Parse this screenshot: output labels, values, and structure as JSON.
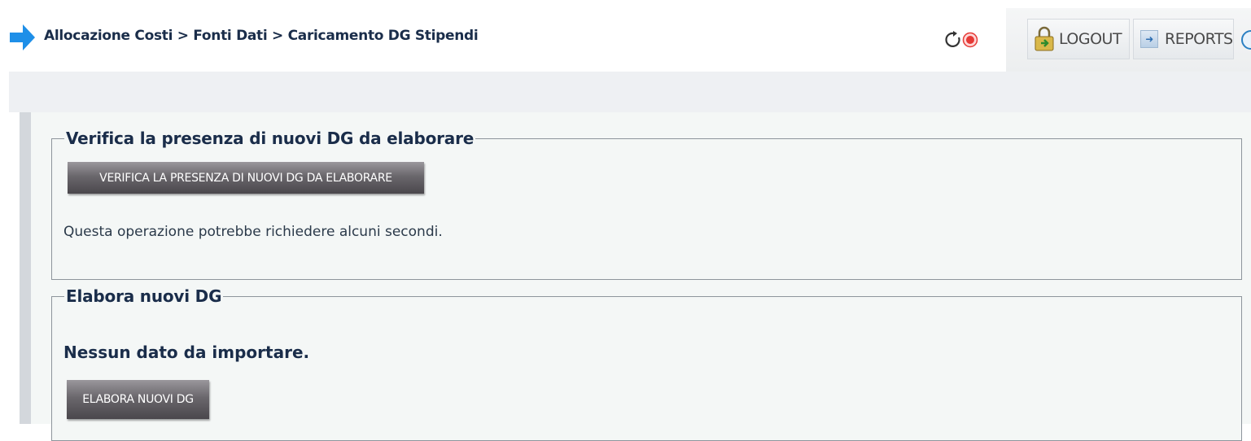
{
  "header": {
    "breadcrumb": "Allocazione Costi > Fonti Dati > Caricamento DG Stipendi",
    "logout_label": "LOGOUT",
    "reports_label": "REPORTS"
  },
  "icons": {
    "nav": "arrow-right-icon",
    "refresh": "refresh-icon",
    "stop": "stop-icon",
    "logout": "lock-icon",
    "reports": "arrow-icon",
    "help": "help-icon"
  },
  "sections": {
    "verify": {
      "legend": "Verifica la presenza di nuovi DG da elaborare",
      "button_label": "VERIFICA LA PRESENZA DI NUOVI DG DA ELABORARE",
      "note": "Questa operazione potrebbe richiedere alcuni secondi."
    },
    "process": {
      "legend": "Elabora nuovi DG",
      "message": "Nessun dato da importare.",
      "button_label": "ELABORA NUOVI DG"
    }
  },
  "colors": {
    "accent_blue": "#1e8fe8",
    "text_dark": "#1a2d4a",
    "stop_red": "#e53935"
  }
}
